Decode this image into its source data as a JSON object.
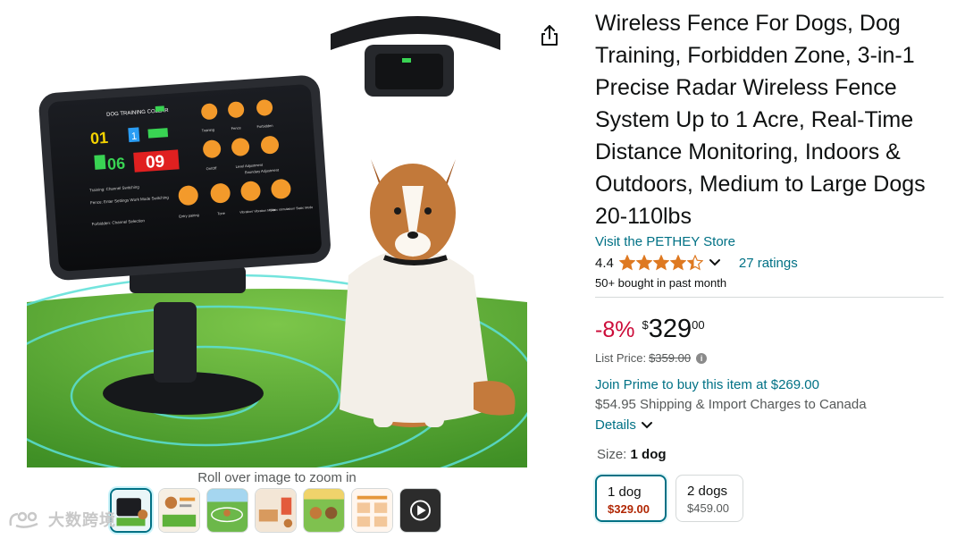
{
  "gallery": {
    "zoom_hint": "Roll over image to zoom in",
    "device_screen": {
      "header": "DOG TRAINING COLLAR",
      "ch1": "01",
      "ch2": "06",
      "ch3": "09",
      "ch_mid": "1",
      "label_training": "Training: Channel Switching",
      "label_fence": "Fence: Enter Settings Work Mode Switching",
      "label_forbidden": "Forbidden: Channel Selection",
      "btn_labels": [
        "Training",
        "Fence",
        "Forbidden",
        "On/Off",
        "Level Adjustment",
        "Boundary Adjustment",
        "Entry pairing",
        "Tone",
        "Vibration/ Vibration Mode",
        "Static stimulation/ Static Mode"
      ]
    },
    "thumbnails": [
      "device-thumb",
      "infographic-thumb",
      "lawn-thumb",
      "room-thumb",
      "dogs-thumb",
      "chart-thumb",
      "video-thumb"
    ],
    "active_thumbnail": 0
  },
  "watermark": {
    "text": "大数跨境"
  },
  "product": {
    "title": "Wireless Fence For Dogs, Dog Training, Forbidden Zone, 3-in-1 Precise Radar Wireless Fence System Up to 1 Acre, Real-Time Distance Monitoring, Indoors & Outdoors, Medium to Large Dogs 20-110lbs",
    "store_link": "Visit the PETHEY Store",
    "rating": {
      "value": "4.4",
      "stars": 4.4,
      "count_text": "27 ratings"
    },
    "bought_text": "50+ bought in past month"
  },
  "price": {
    "discount": "-8%",
    "symbol": "$",
    "whole": "329",
    "fraction": "00",
    "list_price_label": "List Price:",
    "list_price_value": "$359.00"
  },
  "shipping": {
    "prime_text": "Join Prime to buy this item at $269.00",
    "shipping_text": "$54.95 Shipping & Import Charges to Canada",
    "details_label": "Details"
  },
  "size": {
    "label": "Size:",
    "selected": "1 dog",
    "options": [
      {
        "name": "1 dog",
        "price": "$329.00"
      },
      {
        "name": "2 dogs",
        "price": "$459.00"
      }
    ]
  },
  "colors": {
    "link": "#007185",
    "discount": "#cc0c39",
    "star": "#de7921",
    "selected_border": "#007185"
  }
}
